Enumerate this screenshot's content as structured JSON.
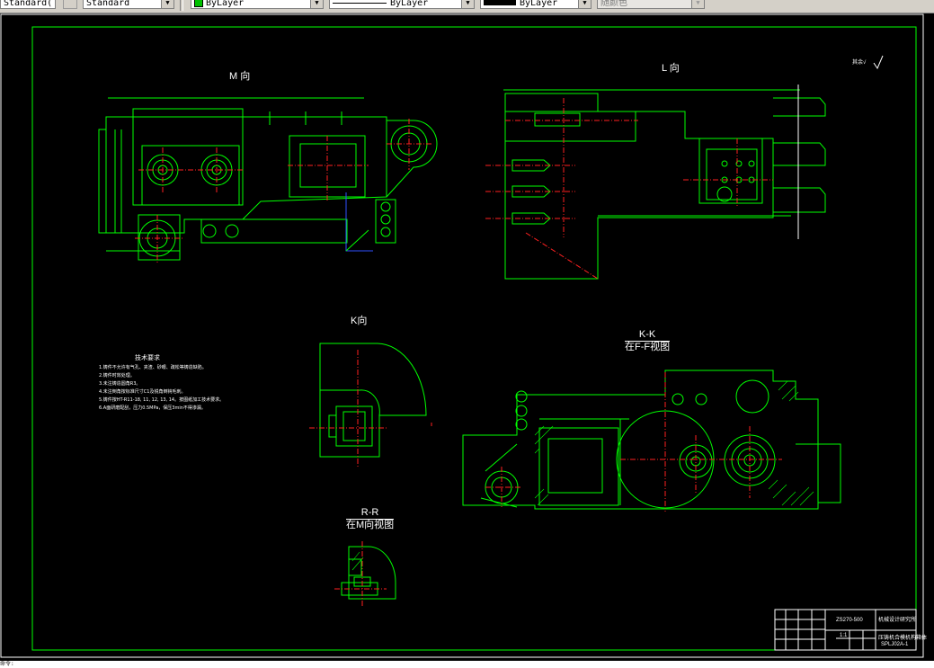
{
  "toolbar": {
    "textstyle_value": "Standard(",
    "dimstyle_value": "Standard",
    "layer_color_value": "ByLayer",
    "layer_color_swatch": "#00c000",
    "linetype_value": "ByLayer",
    "lineweight_value": "ByLayer",
    "plotstyle_value": "随颜色"
  },
  "drawing": {
    "view_m_label": "M 向",
    "view_l_label": "L 向",
    "view_k_label": "K向",
    "section_kk_label": "K-K",
    "section_kk_sub": "在F-F视图",
    "section_rr_label": "R-R",
    "section_rr_sub": "在M向视图",
    "roughness_note": "其余√",
    "tech_title": "技术要求",
    "tech_lines": [
      "1.铸件不允许有气孔、夹渣、砂眼、疏松等铸造缺陷。",
      "2.铸件时效处理。",
      "3.未注铸造圆角R3。",
      "4.未注倒角按标准尺寸C1及锐角倒钝毛刺。",
      "5.铸件按HT-R11-18, 11, 12, 13, 14。按图纸加工技术要求。",
      "6.A面研磨配刮，压力0.5MPa，保压3min不得渗漏。"
    ],
    "title_block": {
      "drawing_code": "ZS270-500",
      "company": "机械设计研究所",
      "part_name": "压铸机合模机构箱体",
      "drawing_number": "SPLJ02A-1",
      "scale_label": "1:1"
    }
  },
  "command_line": {
    "text": "命令:"
  },
  "colors": {
    "line_green": "#00ff00",
    "line_red": "#ff2020",
    "line_white": "#ffffff",
    "line_blue": "#3050ff",
    "line_cyan": "#00ffff"
  }
}
